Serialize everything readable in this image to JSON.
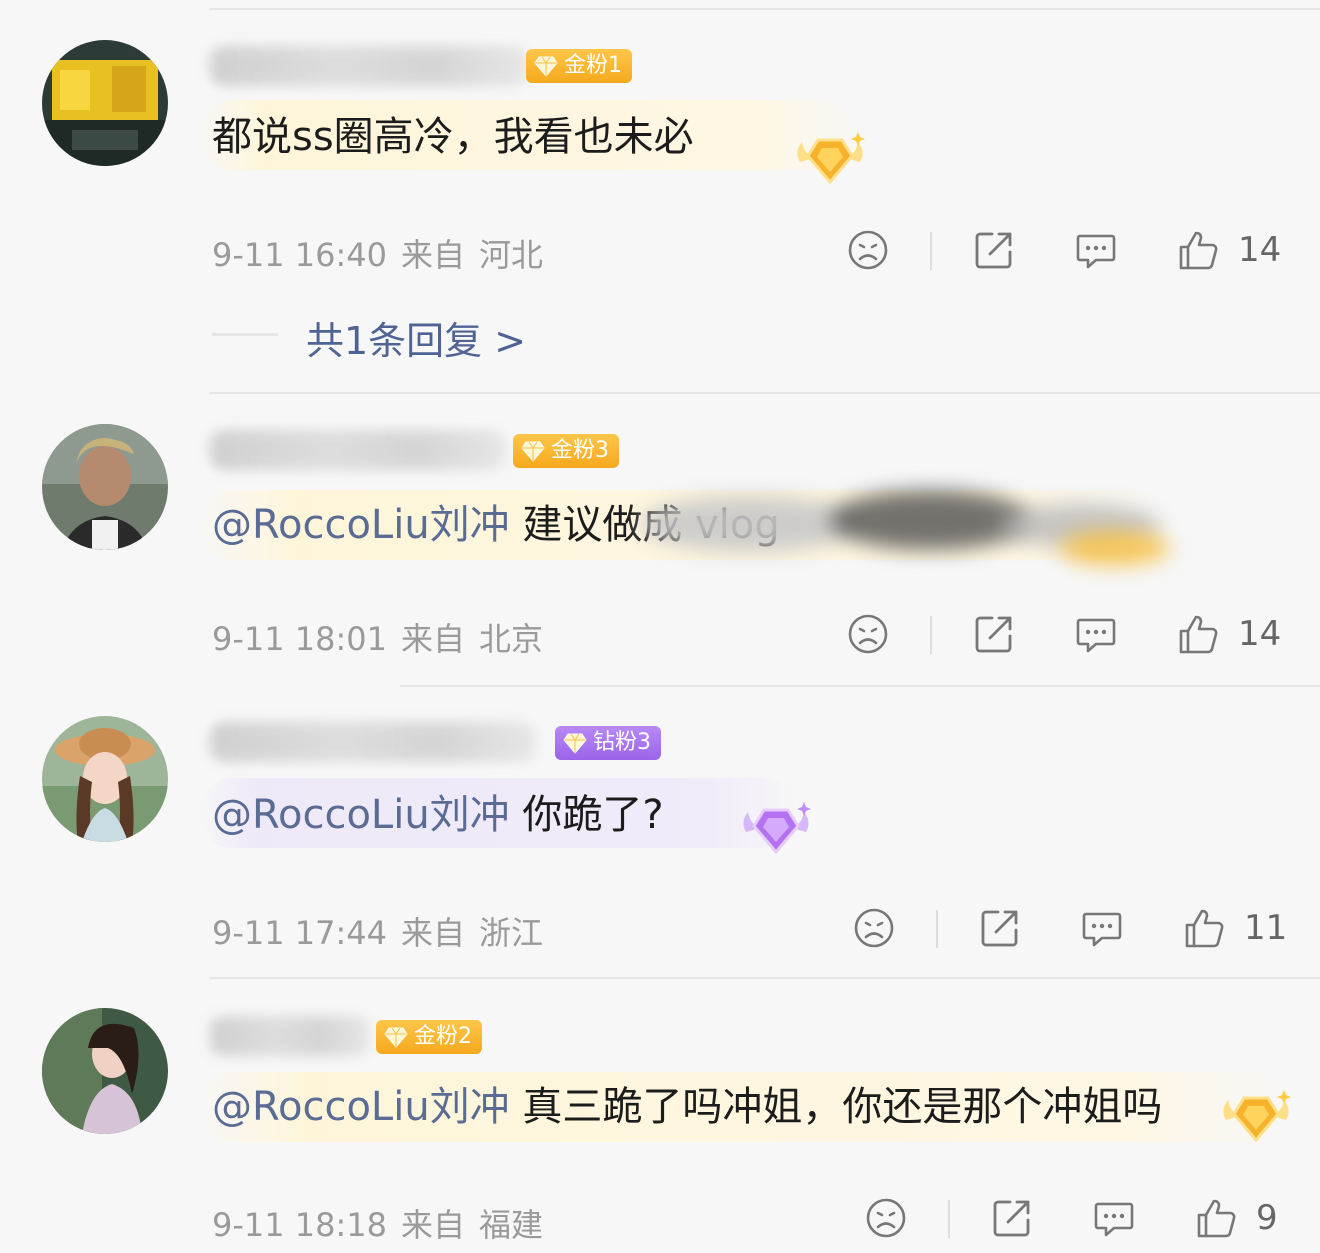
{
  "comments": [
    {
      "badge": "金粉1",
      "text": "都说ss圈高冷，我看也未必",
      "time": "9-11 16:40",
      "from": "来自",
      "location": "河北",
      "likes": "14",
      "reply_link": "共1条回复 >"
    },
    {
      "badge": "金粉3",
      "mention": "@RoccoLiu刘冲",
      "text": " 建议做成 vlog",
      "time": "9-11 18:01",
      "from": "来自",
      "location": "北京",
      "likes": "14"
    },
    {
      "badge": "钻粉3",
      "mention": "@RoccoLiu刘冲",
      "text": " 你跪了?",
      "time": "9-11 17:44",
      "from": "来自",
      "location": "浙江",
      "likes": "11"
    },
    {
      "badge": "金粉2",
      "mention": "@RoccoLiu刘冲",
      "text": " 真三跪了吗冲姐，你还是那个冲姐吗",
      "time": "9-11 18:18",
      "from": "来自",
      "location": "福建",
      "likes": "9"
    }
  ],
  "icons": {
    "dislike": "sad-face-icon",
    "share": "share-icon",
    "comment": "comment-bubble-icon",
    "like": "thumbs-up-icon"
  },
  "colors": {
    "mention": "#5a6b94",
    "gold_badge": "#f5a91d",
    "diamond_badge": "#9a63ea",
    "meta": "#9a9a9a"
  }
}
